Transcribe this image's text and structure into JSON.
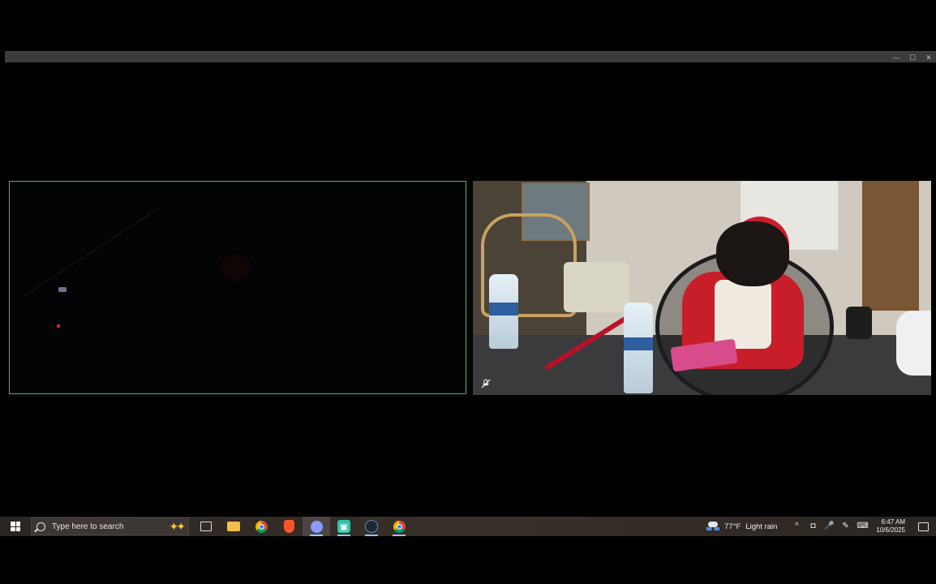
{
  "window": {
    "controls": {
      "minimize": "—",
      "maximize": "☐",
      "close": "✕"
    }
  },
  "video_tiles": [
    {
      "id": "left",
      "description_icon": "camera-feed-dark",
      "active_speaker_border": "#3fbe63"
    },
    {
      "id": "right",
      "muted_icon": "mic-off-icon"
    }
  ],
  "taskbar": {
    "search_placeholder": "Type here to search",
    "pinned": [
      {
        "name": "task-view-icon"
      },
      {
        "name": "file-explorer-icon"
      },
      {
        "name": "chrome-icon"
      },
      {
        "name": "brave-icon"
      },
      {
        "name": "discord-icon"
      },
      {
        "name": "app-icon"
      },
      {
        "name": "steam-icon"
      },
      {
        "name": "chrome-profile-icon"
      }
    ],
    "weather": {
      "temp": "77°F",
      "condition": "Light rain"
    },
    "clock": {
      "time": "6:47 AM",
      "date": "10/6/2025"
    }
  },
  "colors": {
    "active_border": "#3fbe63",
    "taskbar_bg": "#2f2924",
    "accent_underline": "#9ec1ff"
  }
}
